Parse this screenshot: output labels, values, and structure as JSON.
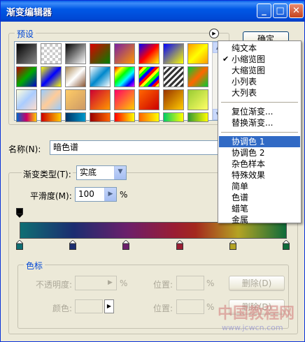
{
  "window": {
    "title": "渐变编辑器"
  },
  "titlebar_buttons": {
    "minimize": "_",
    "maximize": "□",
    "close": "✕"
  },
  "presets": {
    "group_label": "预设",
    "menu_icon": "play-circle-icon",
    "swatches": [
      [
        "linear-gradient(135deg,#000,#888)",
        "repeating-conic-gradient(#ccc 0 25%, #fff 0 50%) 0 0/8px 8px",
        "linear-gradient(135deg,#000,#fff)",
        "linear-gradient(135deg,#d00,#008000)",
        "linear-gradient(135deg,#7a1fa2,#f90)",
        "linear-gradient(135deg,#00f,#f00,#ff0)",
        "linear-gradient(135deg,#00f,#ff0)",
        "linear-gradient(135deg,#f90,#ff0,#f90)"
      ],
      [
        "linear-gradient(135deg,#b00,#0a0,#00c)",
        "linear-gradient(135deg,#ff0,#00f,#ff0)",
        "linear-gradient(135deg,#a85,#fff,#853)",
        "linear-gradient(135deg,#fff,#08c,#fff)",
        "linear-gradient(135deg,#f00,#ff0,#0f0,#0ff,#00f,#f0f)",
        "repeating-linear-gradient(135deg,#f00 0 4px,#ff0 4px 8px,#0f0 8px 12px,#00f 12px 16px)",
        "repeating-linear-gradient(135deg,#333 0 3px,#fff 3px 6px)",
        "linear-gradient(135deg,#0c3,#f60,#0c3)"
      ],
      [
        "linear-gradient(135deg,#ffd,#acf,#fdc)",
        "linear-gradient(135deg,#9cf,#fc9,#9cf)",
        "linear-gradient(135deg,#fc6,#c96)",
        "linear-gradient(135deg,#c03,#f90)",
        "linear-gradient(135deg,#f06,#fc0)",
        "linear-gradient(135deg,#f60,#c00)",
        "linear-gradient(135deg,#930,#fc0)",
        "linear-gradient(135deg,#9c3,#ff6)"
      ],
      [
        "linear-gradient(90deg,#06c,#c06,#fc0)",
        "linear-gradient(90deg,#c00,#fc0)",
        "linear-gradient(90deg,#036,#09c)",
        "linear-gradient(90deg,#900,#f60)",
        "linear-gradient(90deg,#f00,#ff0)",
        "linear-gradient(90deg,#f60,#ff0)",
        "linear-gradient(90deg,#0c6,#ff0)",
        "linear-gradient(90deg,#393,#ff0)"
      ]
    ]
  },
  "buttons": {
    "ok": "确定"
  },
  "name_field": {
    "label": "名称(N):",
    "value": "暗色谱"
  },
  "gradient_type": {
    "group_label": "渐变类型(T):",
    "value": "实底"
  },
  "smoothness": {
    "label": "平滑度(M):",
    "value": "100",
    "unit": "%"
  },
  "color_stops": {
    "group_label": "色标",
    "opacity_label": "不透明度:",
    "opacity_unit": "%",
    "position_label_1": "位置:",
    "position_unit_1": "%",
    "delete_label_1": "删除(D)",
    "color_label": "颜色:",
    "position_label_2": "位置:",
    "position_unit_2": "%",
    "delete_label_2": "删除(D)",
    "stop_colors": [
      "#0e6e73",
      "#1b2d70",
      "#6b1f6b",
      "#9a1d33",
      "#b4a323",
      "#0e6b3a"
    ],
    "opacity_stop_color": "#000000"
  },
  "context_menu": {
    "items": [
      {
        "label": "纯文本",
        "checked": false,
        "highlight": false
      },
      {
        "label": "小缩览图",
        "checked": true,
        "highlight": false
      },
      {
        "label": "大缩览图",
        "checked": false,
        "highlight": false
      },
      {
        "label": "小列表",
        "checked": false,
        "highlight": false
      },
      {
        "label": "大列表",
        "checked": false,
        "highlight": false
      },
      {
        "sep": true
      },
      {
        "label": "复位渐变...",
        "checked": false,
        "highlight": false
      },
      {
        "label": "替换渐变...",
        "checked": false,
        "highlight": false
      },
      {
        "sep": true
      },
      {
        "label": "协调色 1",
        "checked": false,
        "highlight": true
      },
      {
        "label": "协调色 2",
        "checked": false,
        "highlight": false
      },
      {
        "label": "杂色样本",
        "checked": false,
        "highlight": false
      },
      {
        "label": "特殊效果",
        "checked": false,
        "highlight": false
      },
      {
        "label": "简单",
        "checked": false,
        "highlight": false
      },
      {
        "label": "色谱",
        "checked": false,
        "highlight": false
      },
      {
        "label": "蜡笔",
        "checked": false,
        "highlight": false
      },
      {
        "label": "金属",
        "checked": false,
        "highlight": false
      }
    ]
  },
  "watermark": {
    "text": "中国教程网",
    "url": "www.jcwcn.com"
  }
}
